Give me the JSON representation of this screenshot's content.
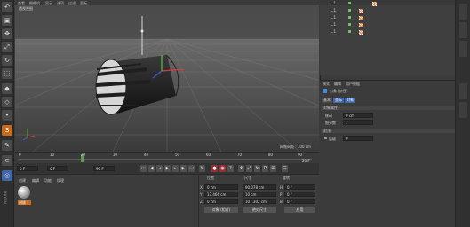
{
  "viewport": {
    "menu_items": [
      "查看",
      "摄像机",
      "显示",
      "选项",
      "过滤",
      "面板"
    ],
    "label": "透视视图",
    "grid_spacing": "网格间距 : 100 cm"
  },
  "objects": {
    "items": [
      {
        "name": "L.1"
      },
      {
        "name": "L.1"
      },
      {
        "name": "L.1"
      },
      {
        "name": "L.1"
      },
      {
        "name": "L.1"
      }
    ]
  },
  "attributes": {
    "menu_items": [
      "模式",
      "编辑",
      "用户数据"
    ],
    "object_title": "对象 [挤压]",
    "tabs": [
      "基本",
      "坐标",
      "对象"
    ],
    "section_object": "对象属性",
    "field1_label": "移动",
    "field1_value": "0 cm",
    "field2_label": "细分数",
    "field2_value": "1",
    "section2": "封顶",
    "level_label": "层级",
    "level_value": "0"
  },
  "timeline": {
    "ticks": [
      "0",
      "10",
      "20",
      "30",
      "40",
      "50",
      "60",
      "70",
      "80",
      "90"
    ],
    "current_frame": "20 F",
    "end_frame": "90 F",
    "frame_start": "0 F",
    "frame_current": "0 F",
    "frame_end": "90 F"
  },
  "materials": {
    "menu_items": [
      "创建",
      "编辑",
      "功能",
      "纹理"
    ],
    "material_name": "材质"
  },
  "coordinates": {
    "headers": [
      "位置",
      "尺寸",
      "旋转"
    ],
    "rows": [
      {
        "axis": "X",
        "pos": "0 cm",
        "size": "90.078 cm",
        "rot_axis": "H",
        "rot": "0 °"
      },
      {
        "axis": "Y",
        "pos": "13.466 cm",
        "size": "10 cm",
        "rot_axis": "P",
        "rot": "0 °"
      },
      {
        "axis": "Z",
        "pos": "0 cm",
        "size": "107.302 cm",
        "rot_axis": "B",
        "rot": "0 °"
      }
    ],
    "mode_select": "对象 (相对)",
    "size_select": "绝对尺寸",
    "apply_button": "应用"
  },
  "left_toolbar_icons": [
    "undo-icon",
    "cube-icon",
    "move-icon",
    "scale-icon",
    "rotate-icon",
    "select-icon",
    "polygon-icon",
    "edge-icon",
    "point-icon",
    "snap-icon",
    "brush-icon",
    "magnet-icon",
    "torus-icon"
  ],
  "colors": {
    "accent": "#3f66a8",
    "active_tool": "#c76a1e",
    "record": "#9b2f2f"
  }
}
